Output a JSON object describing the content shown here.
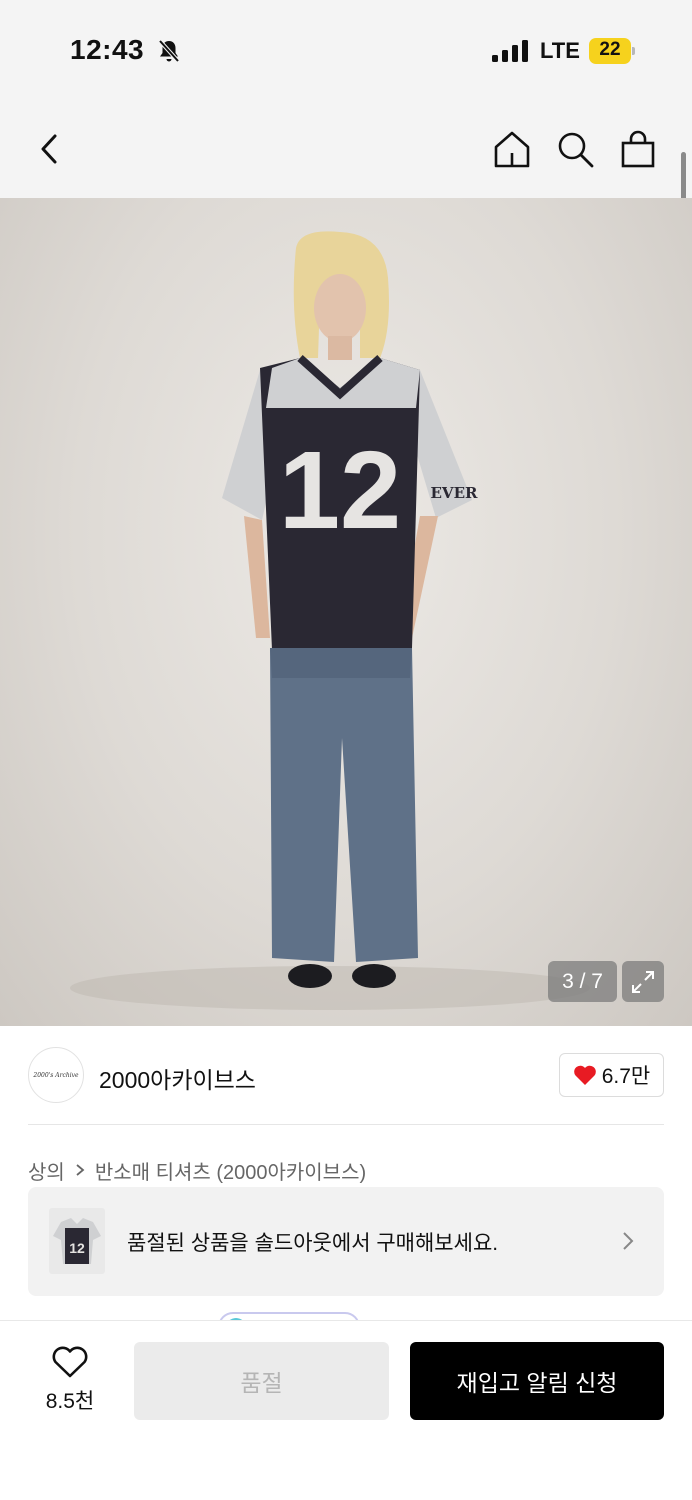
{
  "status_bar": {
    "time": "12:43",
    "network": "LTE",
    "battery_level": "22",
    "battery_color": "#f6d21d"
  },
  "nav": {
    "back_icon": "chevron-left-icon",
    "home_icon": "home-icon",
    "search_icon": "search-icon",
    "cart_icon": "shopping-bag-icon"
  },
  "gallery": {
    "page_indicator": "3 / 7",
    "jersey_number": "12",
    "sleeve_text": "EVER"
  },
  "brand": {
    "logo_text": "2000's Archive",
    "name": "2000아카이브스",
    "like_count": "6.7만"
  },
  "breadcrumb": {
    "category": "상의",
    "subcategory": "반소매 티셔츠 (2000아카이브스)"
  },
  "banner": {
    "thumb_number": "12",
    "text": "품절된 상품을 솔드아웃에서 구매해보세요."
  },
  "bottom_bar": {
    "wish_count": "8.5천",
    "soldout_label": "품절",
    "restock_label": "재입고 알림 신청"
  },
  "colors": {
    "accent": "#000000",
    "heart": "#e81b23",
    "disabled_bg": "#ebebeb"
  }
}
